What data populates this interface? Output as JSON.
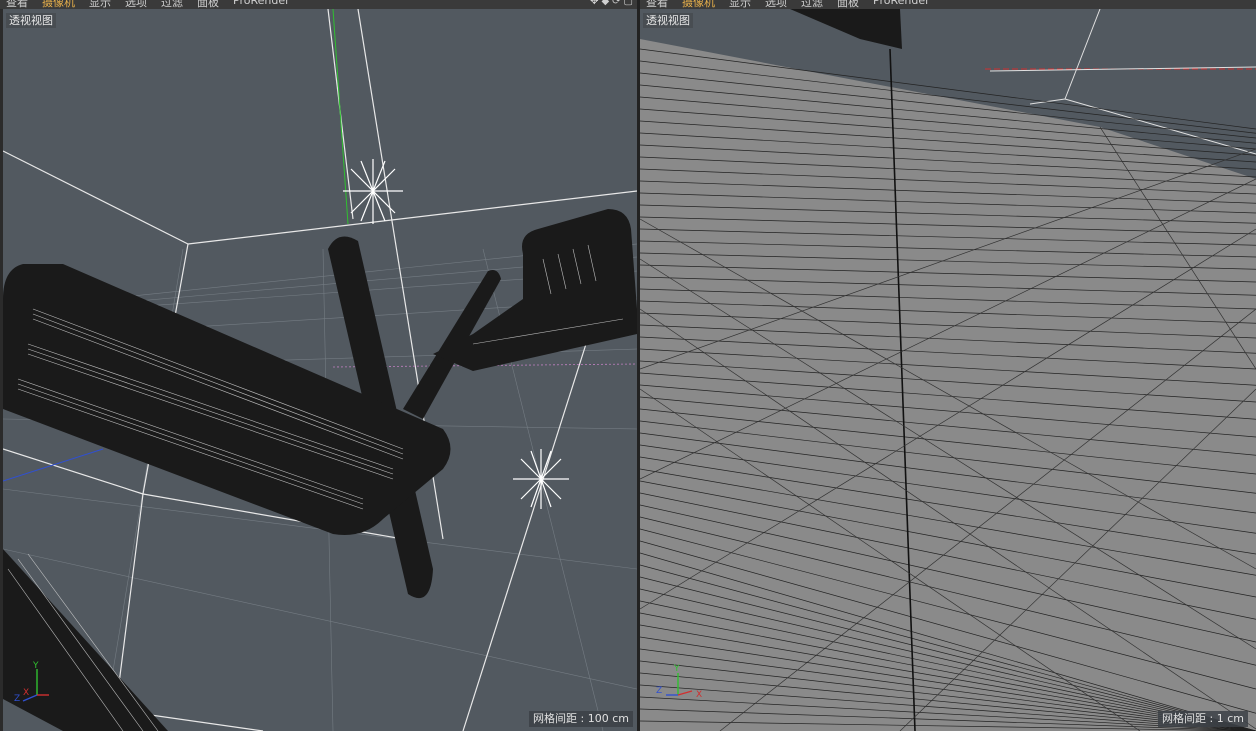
{
  "left_menubar": {
    "items": [
      "查看",
      "摄像机",
      "显示",
      "选项",
      "过滤",
      "面板",
      "ProRender"
    ],
    "active_index": 1
  },
  "right_menubar": {
    "items": [
      "查看",
      "摄像机",
      "显示",
      "选项",
      "过滤",
      "面板",
      "ProRender"
    ],
    "active_index": 1
  },
  "left_viewport": {
    "label": "透视视图",
    "grid_spacing": "网格间距 : 100 cm",
    "axis": {
      "y": "Y",
      "z": "Z",
      "x": "X"
    }
  },
  "right_viewport": {
    "label": "透视视图",
    "grid_spacing": "网格间距 : 1 cm",
    "axis": {
      "y": "Y",
      "z": "Z",
      "x": "X"
    }
  },
  "colors": {
    "viewport_bg": "#525960",
    "floor_grey": "#8a8a8a",
    "mesh_dark": "#1a1a1a",
    "axis_x": "#d03030",
    "axis_y": "#30c030",
    "axis_z": "#3050d0"
  }
}
